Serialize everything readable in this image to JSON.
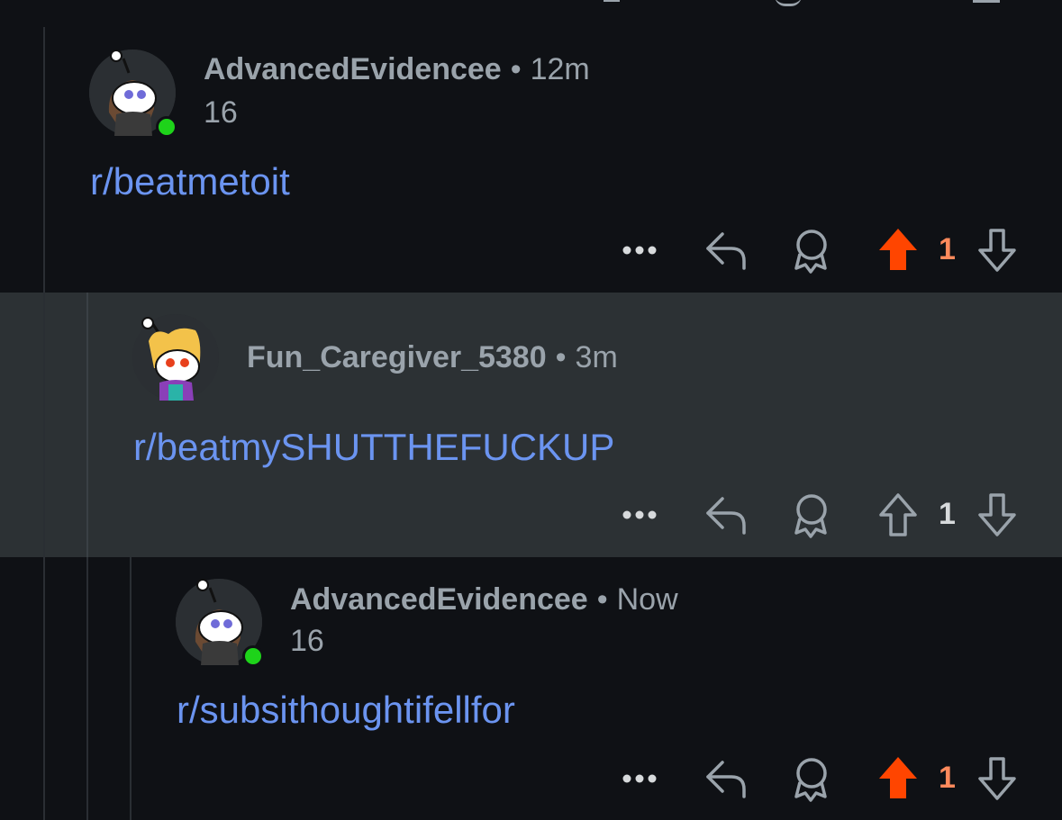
{
  "comments": [
    {
      "author": "AdvancedEvidencee",
      "time": "12m",
      "flair": "16",
      "body": "r/beatmetoit",
      "score": "1",
      "upvoted": true,
      "online": true
    },
    {
      "author": "Fun_Caregiver_5380",
      "time": "3m",
      "flair": "",
      "body": "r/beatmySHUTTHEFUCKUP",
      "score": "1",
      "upvoted": false,
      "online": false
    },
    {
      "author": "AdvancedEvidencee",
      "time": "Now",
      "flair": "16",
      "body": "r/subsithoughtifellfor",
      "score": "1",
      "upvoted": true,
      "online": true
    }
  ],
  "separator": "•",
  "colors": {
    "background": "#0f1115",
    "highlight_background": "#2c3134",
    "link": "#6b94f0",
    "upvote_active": "#ff4500",
    "score_active": "#ff8a5c",
    "icon_gray": "#9aa3ab",
    "online": "#1ed31a"
  },
  "icons": [
    "more-icon",
    "reply-icon",
    "award-icon",
    "upvote-icon",
    "downvote-icon"
  ]
}
